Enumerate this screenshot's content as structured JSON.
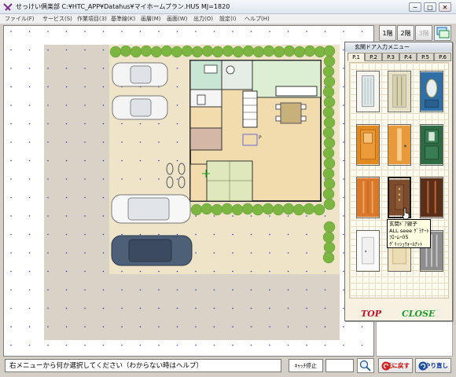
{
  "window": {
    "title": "せっけい倶楽部 C:¥HTC_APP¥Datahus¥マイホームプラン.HUS  MJ=1820",
    "min_label": "─",
    "max_label": "□",
    "close_label": "✕"
  },
  "menu": [
    {
      "label": "ファイル(F)"
    },
    {
      "label": "サービス(S)"
    },
    {
      "label": "作業項目(3)"
    },
    {
      "label": "基準線(K)"
    },
    {
      "label": "画層(M)"
    },
    {
      "label": "画面(W)"
    },
    {
      "label": "出力(O)"
    },
    {
      "label": "設定(I)"
    },
    {
      "label": "ヘルプ(H)"
    }
  ],
  "floors": [
    {
      "label": "1階"
    },
    {
      "label": "2階"
    },
    {
      "label": "3階"
    }
  ],
  "door_panel": {
    "title": "玄関ドア入力メニュー",
    "tabs": [
      "P.1",
      "P.2",
      "P.3",
      "P.4",
      "P.5",
      "P.6"
    ],
    "active_tab": "P.1",
    "doors": [
      {
        "icon": "door-white-glass-icon"
      },
      {
        "icon": "door-cream-slat-icon"
      },
      {
        "icon": "door-blue-oval-icon"
      },
      {
        "icon": "door-orange-panel-icon"
      },
      {
        "icon": "door-orange-light-icon"
      },
      {
        "icon": "door-green-icon"
      },
      {
        "icon": "door-orange-stripe-icon"
      },
      {
        "icon": "door-brown-selected-icon"
      },
      {
        "icon": "door-dark-brown-icon"
      },
      {
        "icon": "door-white-icon"
      },
      {
        "icon": "door-light-wood-icon"
      },
      {
        "icon": "door-gray-slat-icon"
      }
    ],
    "top_label": "TOP",
    "close_label": "CLOSE"
  },
  "tooltip": {
    "lines": [
      "玄関ﾄﾞｱ親子",
      "ALL seee ｸﾞﾗﾅｰﾄ",
      "ﾌﾛｰﾑｰ05",
      "ｸﾞﾘｯｼｭｳｫｰﾙﾅｯﾄ"
    ]
  },
  "status": {
    "message": "右メニューから何か選択してください（わからない時はヘルプ）",
    "cancel_label": "ｷｬｯﾁ停止",
    "undo_label": "元に戻す",
    "redo_label": "やり直し"
  },
  "colors": {
    "lot_gravel": "#d8d3c6",
    "lot_beige": "#efe3c8",
    "hedge": "#7cb542",
    "floor_wood": "#f2dcae",
    "tatami": "#dfe8bc",
    "water": "#c9e6d4",
    "wall": "#333333",
    "grid_dot": "#2b39c4"
  }
}
